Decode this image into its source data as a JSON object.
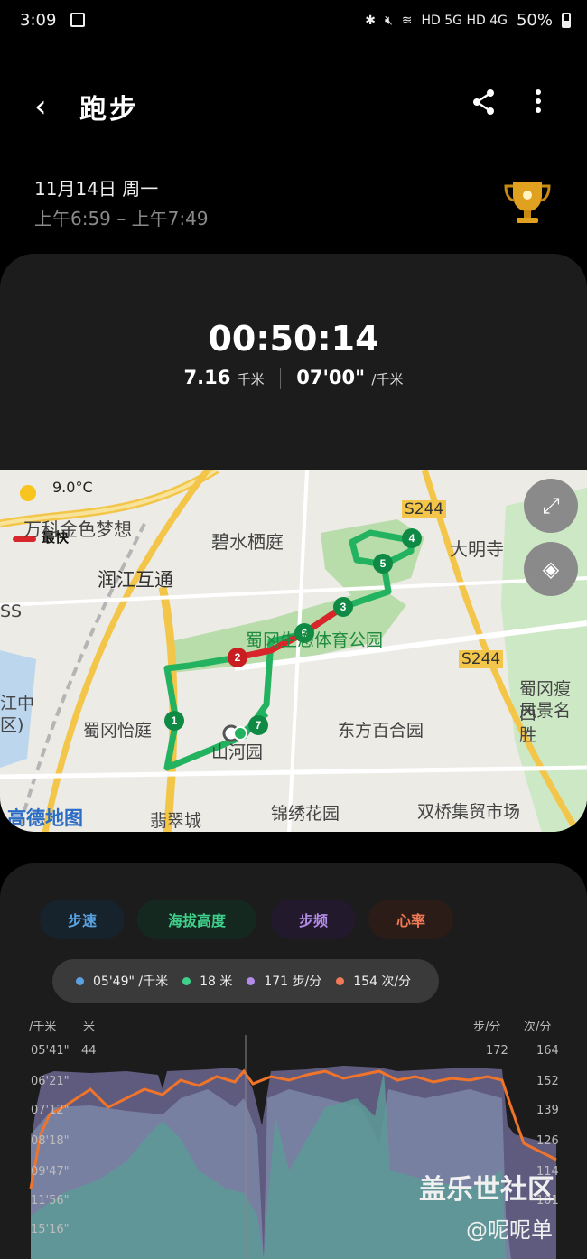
{
  "status": {
    "time": "3:09",
    "indicators": "HD 5G HD 4G",
    "battery": "50%"
  },
  "header": {
    "title": "跑步"
  },
  "session": {
    "date": "11月14日 周一",
    "time_range": "上午6:59 – 上午7:49"
  },
  "summary": {
    "duration": "00:50:14",
    "distance": "7.16",
    "distance_unit": "千米",
    "pace": "07'00\"",
    "pace_unit": "/千米"
  },
  "map": {
    "weather": "9.0°C",
    "fastest_label": "最快",
    "attribution": "高德地图",
    "places": [
      "万科金色梦想",
      "碧水栖庭",
      "润江互通",
      "蜀冈生态体育公园",
      "大明寺",
      "S244",
      "S244",
      "蜀冈瘦西",
      "风景名胜",
      "江中",
      "区)",
      "蜀冈怡庭",
      "山河园",
      "东方百合园",
      "锦绣花园",
      "双桥集贸市场",
      "翡翠城",
      "SS"
    ],
    "markers": [
      "1",
      "2",
      "3",
      "4",
      "5",
      "6",
      "7"
    ]
  },
  "chart": {
    "tabs": [
      "步速",
      "海拔高度",
      "步频",
      "心率"
    ],
    "tooltip": {
      "pace": "05'49\" /千米",
      "altitude": "18 米",
      "cadence": "171 步/分",
      "heart_rate": "154 次/分"
    },
    "axis_headers": {
      "pace": "/千米",
      "alt": "米",
      "cad": "步/分",
      "hr": "次/分"
    },
    "pace_ticks": [
      "05'41\"",
      "06'21\"",
      "07'12\"",
      "08'18\"",
      "09'47\"",
      "11'56\"",
      "15'16\""
    ],
    "alt_top": "44",
    "cad_top": "172",
    "hr_ticks": [
      "164",
      "152",
      "139",
      "126",
      "114",
      "101"
    ],
    "colors": {
      "pace": "#5aa3e0",
      "altitude": "#3fd18c",
      "cadence": "#b38be8",
      "heart_rate": "#ef7a55"
    }
  },
  "watermark": {
    "line1": "盖乐世社区",
    "line2": "@呢呢单"
  }
}
